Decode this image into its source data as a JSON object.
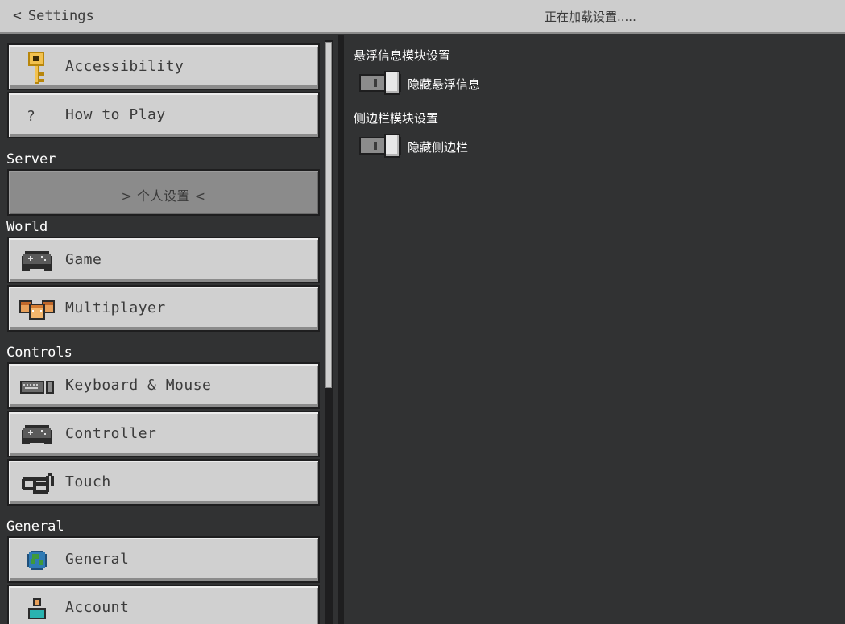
{
  "header": {
    "back_label": "Settings",
    "status_text": "正在加载设置....."
  },
  "sidebar": {
    "buttons_top": [
      {
        "label": "Accessibility",
        "icon": "key-icon"
      },
      {
        "label": "How to Play",
        "icon": "question-icon",
        "icon_glyph": "?"
      }
    ],
    "sections": {
      "server": "Server",
      "world": "World",
      "controls": "Controls",
      "general": "General"
    },
    "server_items": [
      {
        "label": "> 个人设置 <",
        "selected": true
      }
    ],
    "world_items": [
      {
        "label": "Game",
        "icon": "gamepad-icon"
      },
      {
        "label": "Multiplayer",
        "icon": "players-icon"
      }
    ],
    "controls_items": [
      {
        "label": "Keyboard & Mouse",
        "icon": "keyboard-mouse-icon"
      },
      {
        "label": "Controller",
        "icon": "gamepad-icon"
      },
      {
        "label": "Touch",
        "icon": "touch-icon"
      }
    ],
    "general_items": [
      {
        "label": "General",
        "icon": "globe-icon"
      },
      {
        "label": "Account",
        "icon": "account-icon"
      }
    ]
  },
  "main": {
    "modules": [
      {
        "title": "悬浮信息模块设置",
        "toggle_label": "隐藏悬浮信息",
        "toggle_on": false
      },
      {
        "title": "侧边栏模块设置",
        "toggle_label": "隐藏侧边栏",
        "toggle_on": false
      }
    ]
  },
  "colors": {
    "background": "#313233",
    "button_face": "#d0d0d0",
    "button_selected": "#8b8b8b",
    "topbar": "#cdcdcd"
  }
}
